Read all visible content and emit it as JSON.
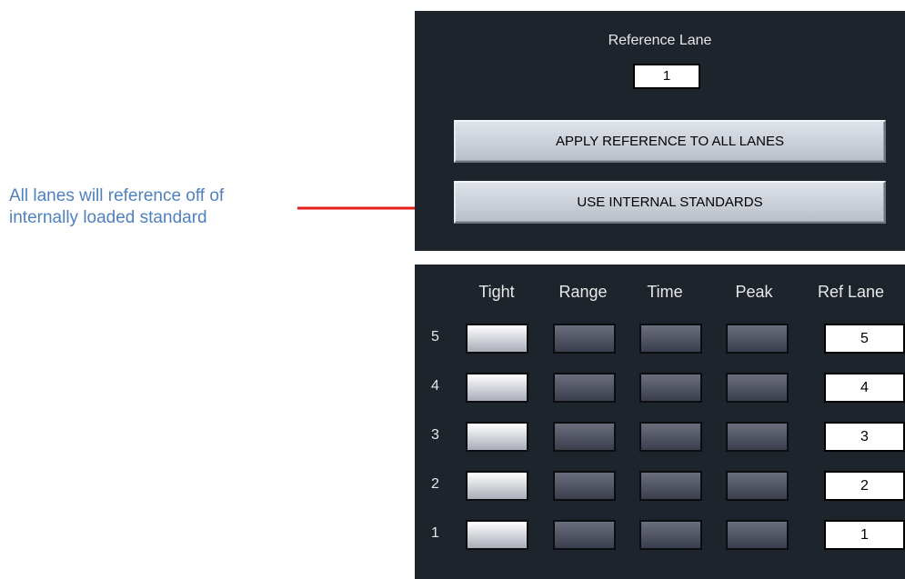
{
  "annotation": {
    "line1": "All lanes will reference off of",
    "line2": "internally loaded standard",
    "color": "#4f81bd",
    "arrow_color": "#e31c1c"
  },
  "reference_panel": {
    "label": "Reference Lane",
    "value": "1",
    "apply_button": "APPLY REFERENCE TO ALL LANES",
    "internal_button": "USE INTERNAL STANDARDS"
  },
  "lane_grid": {
    "headers": [
      "Tight",
      "Range",
      "Time",
      "Peak",
      "Ref Lane"
    ],
    "rows": [
      {
        "label": "5",
        "tight": true,
        "range": false,
        "time": false,
        "peak": false,
        "ref_lane": "5"
      },
      {
        "label": "4",
        "tight": true,
        "range": false,
        "time": false,
        "peak": false,
        "ref_lane": "4"
      },
      {
        "label": "3",
        "tight": true,
        "range": false,
        "time": false,
        "peak": false,
        "ref_lane": "3"
      },
      {
        "label": "2",
        "tight": true,
        "range": false,
        "time": false,
        "peak": false,
        "ref_lane": "2"
      },
      {
        "label": "1",
        "tight": true,
        "range": false,
        "time": false,
        "peak": false,
        "ref_lane": "1"
      }
    ]
  },
  "colors": {
    "panel_bg": "#1e242b",
    "toggle_on": "#e4e6ec",
    "toggle_off": "#4e5161"
  }
}
